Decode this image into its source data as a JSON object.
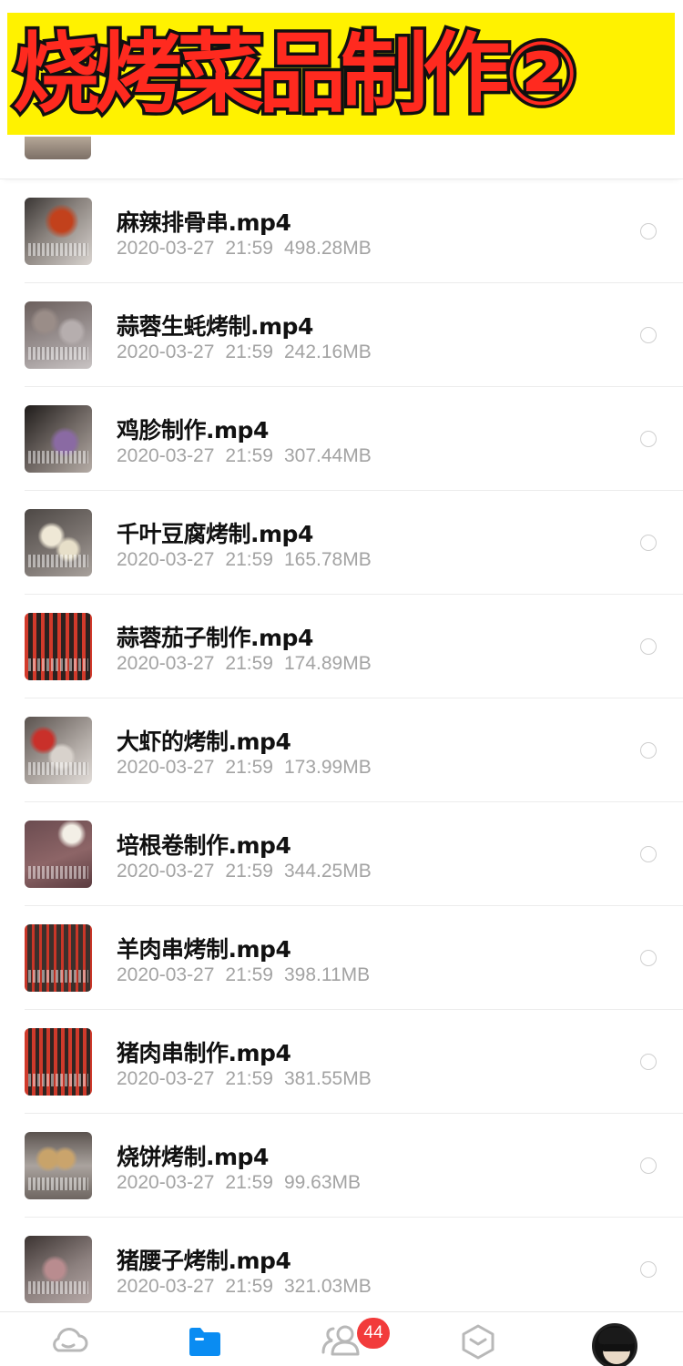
{
  "banner": {
    "title": "烧烤菜品制作②"
  },
  "files": [
    {
      "name": "麻辣排骨串.mp4",
      "date": "2020-03-27",
      "time": "21:59",
      "size": "498.28MB",
      "thumb": "t0"
    },
    {
      "name": "蒜蓉生蚝烤制.mp4",
      "date": "2020-03-27",
      "time": "21:59",
      "size": "242.16MB",
      "thumb": "t1"
    },
    {
      "name": "鸡胗制作.mp4",
      "date": "2020-03-27",
      "time": "21:59",
      "size": "307.44MB",
      "thumb": "t2"
    },
    {
      "name": "千叶豆腐烤制.mp4",
      "date": "2020-03-27",
      "time": "21:59",
      "size": "165.78MB",
      "thumb": "t3"
    },
    {
      "name": "蒜蓉茄子制作.mp4",
      "date": "2020-03-27",
      "time": "21:59",
      "size": "174.89MB",
      "thumb": "t4"
    },
    {
      "name": "大虾的烤制.mp4",
      "date": "2020-03-27",
      "time": "21:59",
      "size": "173.99MB",
      "thumb": "t5"
    },
    {
      "name": "培根卷制作.mp4",
      "date": "2020-03-27",
      "time": "21:59",
      "size": "344.25MB",
      "thumb": "t6"
    },
    {
      "name": "羊肉串烤制.mp4",
      "date": "2020-03-27",
      "time": "21:59",
      "size": "398.11MB",
      "thumb": "t7"
    },
    {
      "name": "猪肉串制作.mp4",
      "date": "2020-03-27",
      "time": "21:59",
      "size": "381.55MB",
      "thumb": "t8"
    },
    {
      "name": "烧饼烤制.mp4",
      "date": "2020-03-27",
      "time": "21:59",
      "size": "99.63MB",
      "thumb": "t9"
    },
    {
      "name": "猪腰子烤制.mp4",
      "date": "2020-03-27",
      "time": "21:59",
      "size": "321.03MB",
      "thumb": "t10"
    }
  ],
  "bottom_nav": {
    "items": [
      {
        "name": "home",
        "icon": "cloud-icon",
        "active": false
      },
      {
        "name": "files",
        "icon": "folder-icon",
        "active": true
      },
      {
        "name": "share",
        "icon": "people-icon",
        "active": false,
        "badge": "44"
      },
      {
        "name": "apps",
        "icon": "box-icon",
        "active": false
      },
      {
        "name": "profile",
        "icon": "avatar",
        "active": false
      }
    ],
    "active_color": "#0a8cf2",
    "inactive_color": "#b8b8b8",
    "badge_color": "#f23b3b"
  },
  "colors": {
    "banner_bg": "#fff200",
    "banner_text": "#ff2a1f",
    "meta_text": "#a3a3a3"
  }
}
